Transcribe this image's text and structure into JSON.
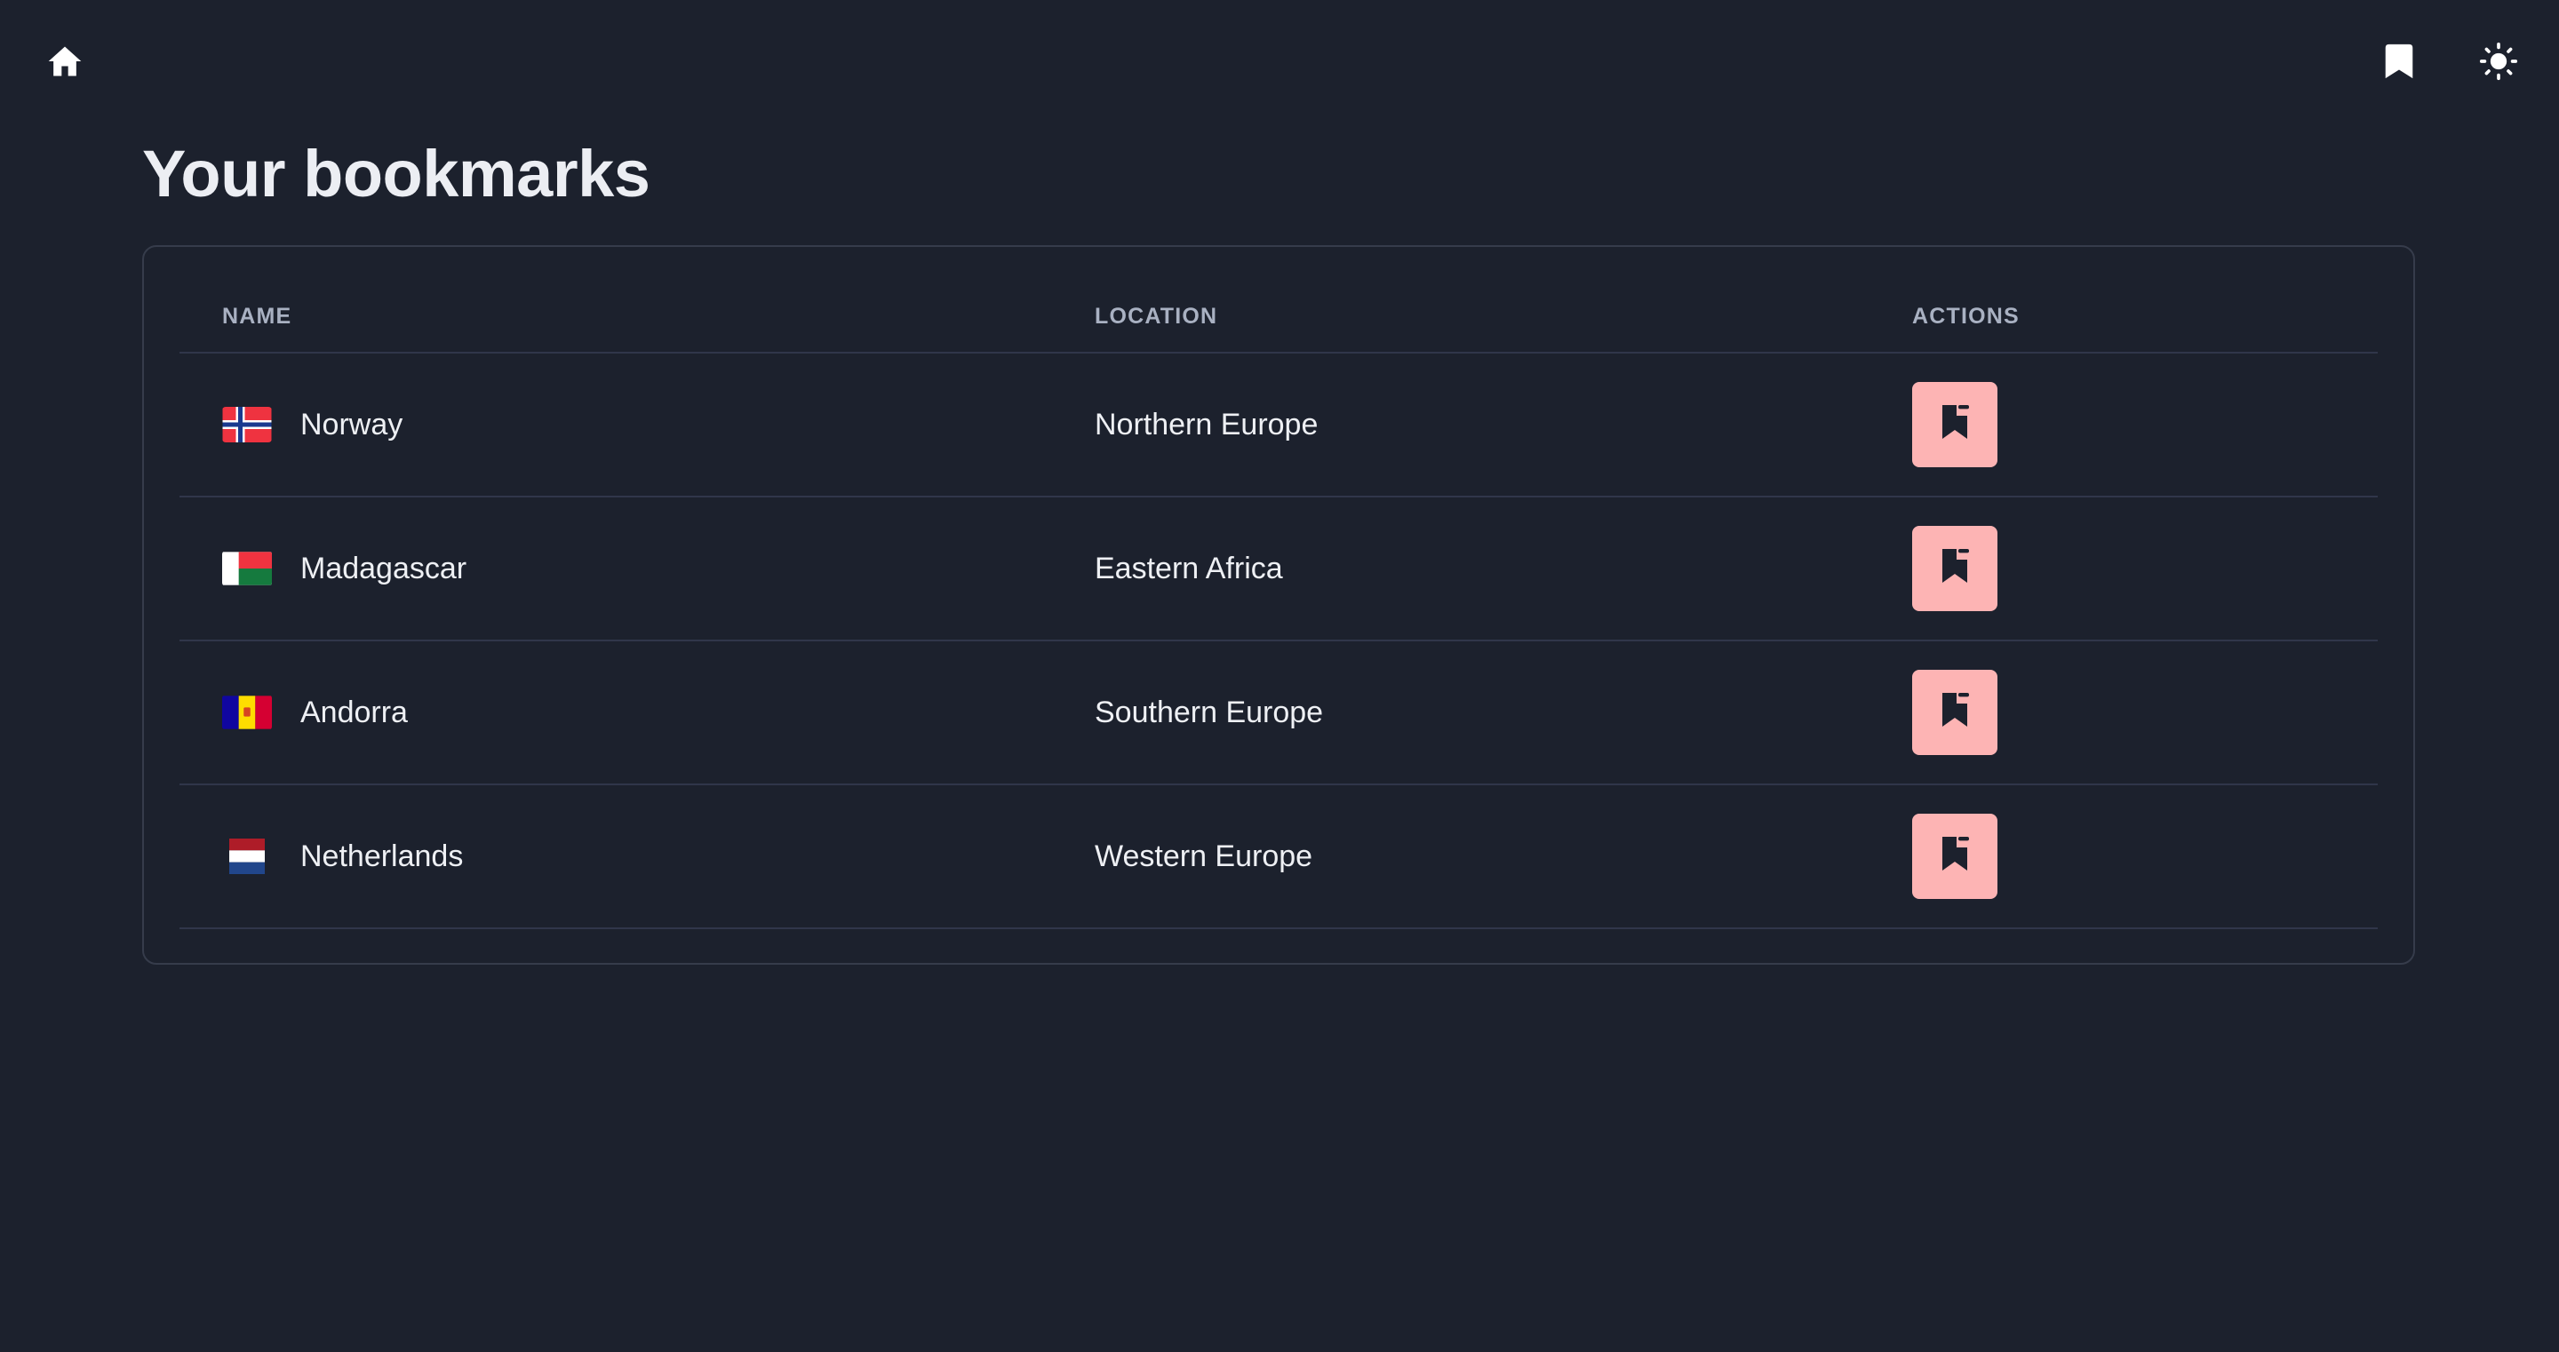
{
  "nav": {
    "home_icon": "home-icon",
    "bookmarks_icon": "bookmark-icon",
    "theme_icon": "sun-icon"
  },
  "page": {
    "title": "Your bookmarks"
  },
  "table": {
    "columns": [
      "NAME",
      "LOCATION",
      "ACTIONS"
    ],
    "rows": [
      {
        "name": "Norway",
        "location": "Northern Europe",
        "flag": "norway-flag-icon",
        "action_icon": "bookmark-remove-icon"
      },
      {
        "name": "Madagascar",
        "location": "Eastern Africa",
        "flag": "madagascar-flag-icon",
        "action_icon": "bookmark-remove-icon"
      },
      {
        "name": "Andorra",
        "location": "Southern Europe",
        "flag": "andorra-flag-icon",
        "action_icon": "bookmark-remove-icon"
      },
      {
        "name": "Netherlands",
        "location": "Western Europe",
        "flag": "netherlands-flag-icon",
        "action_icon": "bookmark-remove-icon"
      }
    ]
  },
  "colors": {
    "background": "#1c212d",
    "action_button": "#fdb4b4",
    "header_text": "#a9b1c2"
  }
}
